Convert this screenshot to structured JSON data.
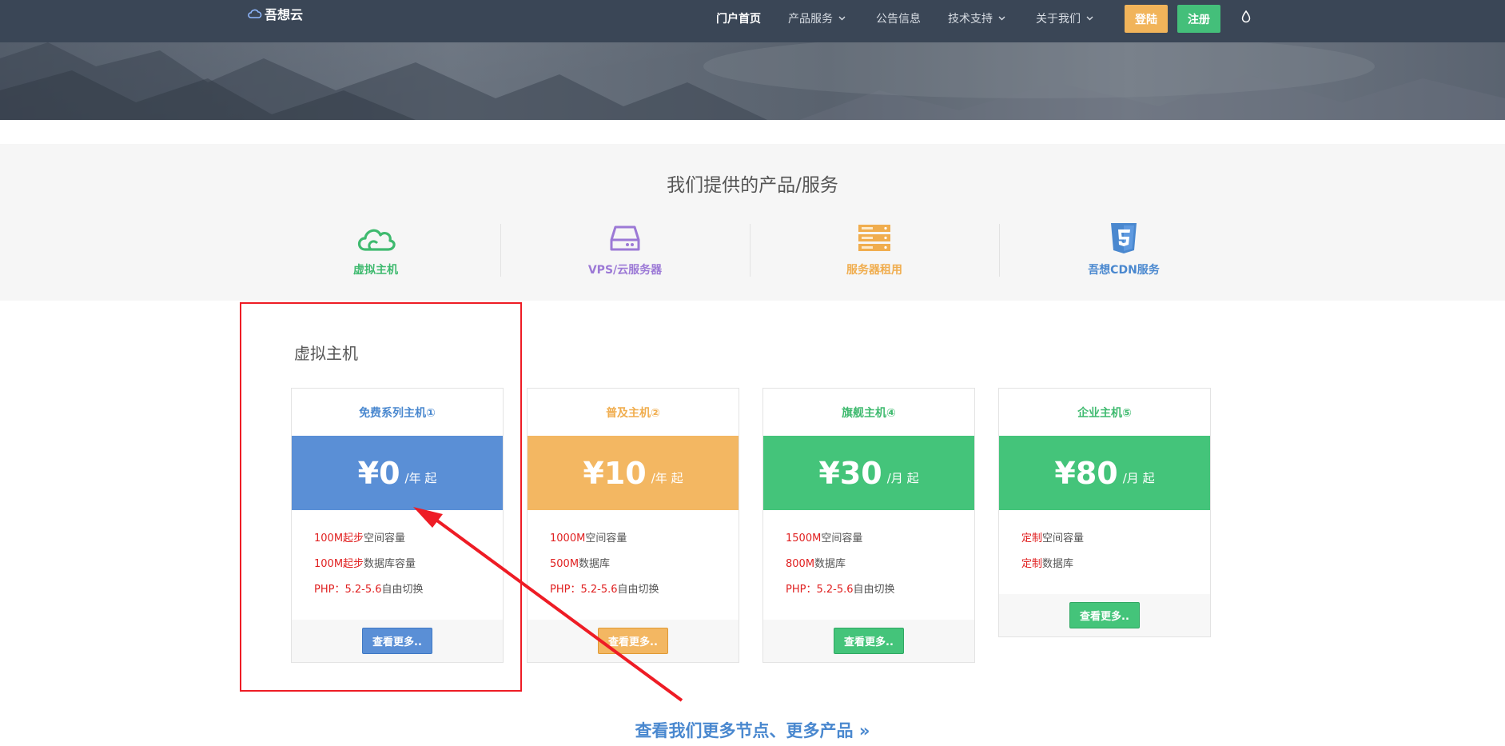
{
  "colors": {
    "nav_bg": "#3a4656",
    "login": "#f1b45a",
    "register": "#44bf7a",
    "blue": "#5a8fd6",
    "orange": "#f3b762",
    "green": "#44c47a",
    "purple": "#9c79d6",
    "annotation_red": "#ee1c25"
  },
  "header": {
    "logo_text": "吾想云",
    "nav": [
      "门户首页",
      "产品服务",
      "公告信息",
      "技术支持",
      "关于我们"
    ],
    "login_label": "登陆",
    "register_label": "注册"
  },
  "services": {
    "title": "我们提供的产品/服务",
    "items": [
      {
        "label": "虚拟主机",
        "icon": "cloud-icon",
        "color": "#3fba6f"
      },
      {
        "label": "VPS/云服务器",
        "icon": "hard-drive-icon",
        "color": "#9c79d6"
      },
      {
        "label": "服务器租用",
        "icon": "server-rack-icon",
        "color": "#f0ad4e"
      },
      {
        "label": "吾想CDN服务",
        "icon": "html5-shield-icon",
        "color": "#4a88cf"
      }
    ]
  },
  "hosting": {
    "title": "虚拟主机",
    "more_button_label": "查看更多..",
    "cards": [
      {
        "name": "免费系列主机①",
        "price": "¥0",
        "unit": "/年 起",
        "color": "#5a8fd6",
        "features": [
          {
            "hl": "100M起步",
            "text": "空间容量"
          },
          {
            "hl": "100M起步",
            "text": "数据库容量"
          },
          {
            "hl": "PHP：5.2-5.6",
            "text": "自由切换"
          }
        ]
      },
      {
        "name": "普及主机②",
        "price": "¥10",
        "unit": "/年 起",
        "color": "#f3b762",
        "features": [
          {
            "hl": "1000M",
            "text": "空间容量"
          },
          {
            "hl": "500M",
            "text": "数据库"
          },
          {
            "hl": "PHP：5.2-5.6",
            "text": "自由切换"
          }
        ]
      },
      {
        "name": "旗舰主机④",
        "price": "¥30",
        "unit": "/月 起",
        "color": "#44c47a",
        "features": [
          {
            "hl": "1500M",
            "text": "空间容量"
          },
          {
            "hl": "800M",
            "text": "数据库"
          },
          {
            "hl": "PHP：5.2-5.6",
            "text": "自由切换"
          }
        ]
      },
      {
        "name": "企业主机⑤",
        "price": "¥80",
        "unit": "/月 起",
        "color": "#44c47a",
        "features": [
          {
            "hl": "定制",
            "text": "空间容量"
          },
          {
            "hl": "定制",
            "text": "数据库"
          }
        ]
      }
    ]
  },
  "more_link": "查看我们更多节点、更多产品 »"
}
